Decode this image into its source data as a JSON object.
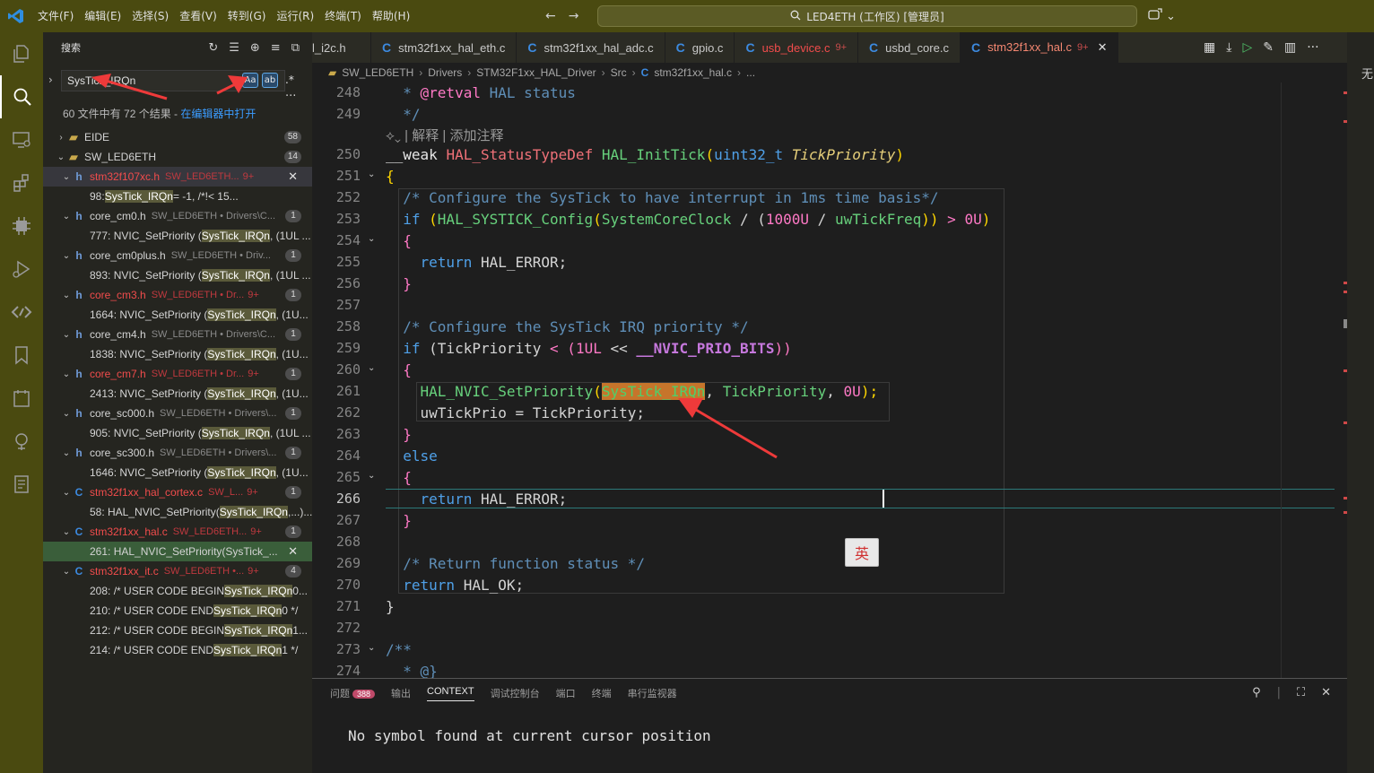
{
  "app": {
    "menu": [
      "文件(F)",
      "编辑(E)",
      "选择(S)",
      "查看(V)",
      "转到(G)",
      "运行(R)",
      "终端(T)",
      "帮助(H)"
    ],
    "search_center": "LED4ETH (工作区) [管理员]"
  },
  "activity_icons": [
    "explorer-icon",
    "search-icon",
    "remote-explorer-icon",
    "extensions-icon",
    "chip-icon",
    "run-debug-icon",
    "code-icon",
    "bookmark-icon",
    "calendar-icon",
    "bug-icon",
    "notes-icon"
  ],
  "sidebar": {
    "title": "搜索",
    "query": "SysTick_IRQn",
    "opt_case": "Aa",
    "opt_word": "ab",
    "opt_regex": ".*",
    "summary_prefix": "60 文件中有 72 个结果 - ",
    "summary_link": "在编辑器中打开",
    "tree": [
      {
        "kind": "folder",
        "name": "EIDE",
        "badge": "58",
        "expanded": false
      },
      {
        "kind": "folder",
        "name": "SW_LED6ETH",
        "badge": "14",
        "expanded": true
      },
      {
        "kind": "file",
        "type": "h",
        "name": "stm32f107xc.h",
        "path": "SW_LED6ETH...",
        "count": "9+",
        "error": true,
        "selected": true
      },
      {
        "kind": "match",
        "line": "98: ",
        "hl": "SysTick_IRQn",
        "rest": "            = -1,     /*!< 15..."
      },
      {
        "kind": "file",
        "type": "h",
        "name": "core_cm0.h",
        "path": "SW_LED6ETH • Drivers\\C...",
        "badge": "1"
      },
      {
        "kind": "match",
        "line": "777: NVIC_SetPriority (",
        "hl": "SysTick_IRQn",
        "rest": ", (1UL ..."
      },
      {
        "kind": "file",
        "type": "h",
        "name": "core_cm0plus.h",
        "path": "SW_LED6ETH • Driv...",
        "badge": "1"
      },
      {
        "kind": "match",
        "line": "893: NVIC_SetPriority (",
        "hl": "SysTick_IRQn",
        "rest": ", (1UL ..."
      },
      {
        "kind": "file",
        "type": "h",
        "name": "core_cm3.h",
        "path": "SW_LED6ETH • Dr...",
        "count": "9+",
        "badge": "1",
        "error": true
      },
      {
        "kind": "match",
        "line": "1664: NVIC_SetPriority (",
        "hl": "SysTick_IRQn",
        "rest": ", (1U..."
      },
      {
        "kind": "file",
        "type": "h",
        "name": "core_cm4.h",
        "path": "SW_LED6ETH • Drivers\\C...",
        "badge": "1"
      },
      {
        "kind": "match",
        "line": "1838: NVIC_SetPriority (",
        "hl": "SysTick_IRQn",
        "rest": ", (1U..."
      },
      {
        "kind": "file",
        "type": "h",
        "name": "core_cm7.h",
        "path": "SW_LED6ETH • Dr...",
        "count": "9+",
        "badge": "1",
        "error": true
      },
      {
        "kind": "match",
        "line": "2413: NVIC_SetPriority (",
        "hl": "SysTick_IRQn",
        "rest": ", (1U..."
      },
      {
        "kind": "file",
        "type": "h",
        "name": "core_sc000.h",
        "path": "SW_LED6ETH • Drivers\\...",
        "badge": "1"
      },
      {
        "kind": "match",
        "line": "905: NVIC_SetPriority (",
        "hl": "SysTick_IRQn",
        "rest": ", (1UL ..."
      },
      {
        "kind": "file",
        "type": "h",
        "name": "core_sc300.h",
        "path": "SW_LED6ETH • Drivers\\...",
        "badge": "1"
      },
      {
        "kind": "match",
        "line": "1646: NVIC_SetPriority (",
        "hl": "SysTick_IRQn",
        "rest": ", (1U..."
      },
      {
        "kind": "file",
        "type": "c",
        "name": "stm32f1xx_hal_cortex.c",
        "path": "SW_L...",
        "count": "9+",
        "badge": "1",
        "error": true
      },
      {
        "kind": "match",
        "line": "58: HAL_NVIC_SetPriority(",
        "hl": "SysTick_IRQn",
        "rest": ",...)..."
      },
      {
        "kind": "file",
        "type": "c",
        "name": "stm32f1xx_hal.c",
        "path": "SW_LED6ETH...",
        "count": "9+",
        "badge": "1",
        "error": true
      },
      {
        "kind": "match",
        "line": "261: HAL_NVIC_SetPriority(SysTick_...",
        "hl": "",
        "rest": "",
        "selected": true
      },
      {
        "kind": "file",
        "type": "c",
        "name": "stm32f1xx_it.c",
        "path": "SW_LED6ETH •...",
        "count": "9+",
        "badge": "4",
        "error": true
      },
      {
        "kind": "match",
        "line": "208: /* USER CODE BEGIN ",
        "hl": "SysTick_IRQn",
        "rest": " 0..."
      },
      {
        "kind": "match",
        "line": "210: /* USER CODE END ",
        "hl": "SysTick_IRQn",
        "rest": " 0 */"
      },
      {
        "kind": "match",
        "line": "212: /* USER CODE BEGIN ",
        "hl": "SysTick_IRQn",
        "rest": " 1..."
      },
      {
        "kind": "match",
        "line": "214: /* USER CODE END ",
        "hl": "SysTick_IRQn",
        "rest": " 1 */"
      }
    ]
  },
  "tabs": [
    {
      "label": "l_i2c.h",
      "icon": false
    },
    {
      "label": "stm32f1xx_hal_eth.c",
      "icon": true
    },
    {
      "label": "stm32f1xx_hal_adc.c",
      "icon": true
    },
    {
      "label": "gpio.c",
      "icon": true
    },
    {
      "label": "usb_device.c",
      "icon": true,
      "error": true,
      "count": "9+"
    },
    {
      "label": "usbd_core.c",
      "icon": true
    },
    {
      "label": "stm32f1xx_hal.c",
      "icon": true,
      "active": true,
      "count": "9+"
    }
  ],
  "breadcrumb": [
    "SW_LED6ETH",
    "Drivers",
    "STM32F1xx_HAL_Driver",
    "Src",
    "stm32f1xx_hal.c",
    "..."
  ],
  "codelens": "| 解释 | 添加注释",
  "code_lines": [
    {
      "n": "248",
      "segs": [
        [
          "  * ",
          "k-cm"
        ],
        [
          "@retval",
          "k-nm"
        ],
        [
          " HAL status",
          "k-cm"
        ]
      ]
    },
    {
      "n": "249",
      "segs": [
        [
          "  */",
          "k-cm"
        ]
      ]
    },
    {
      "n": "250",
      "segs": [
        [
          "__weak",
          "k-wk"
        ],
        [
          " ",
          "k-pu"
        ],
        [
          "HAL_StatusTypeDef",
          "k-ty"
        ],
        [
          " ",
          "k-pu"
        ],
        [
          "HAL_InitTick",
          "k-fn"
        ],
        [
          "(",
          "k-bp"
        ],
        [
          "uint32_t",
          "k-kw"
        ],
        [
          " ",
          "k-pu"
        ],
        [
          "TickPriority",
          "k-it"
        ],
        [
          ")",
          "k-bp"
        ]
      ]
    },
    {
      "n": "251",
      "fold": true,
      "segs": [
        [
          "{",
          "k-bp"
        ]
      ]
    },
    {
      "n": "252",
      "segs": [
        [
          "  /* Configure the SysTick to have interrupt in 1ms time basis*/",
          "k-cm"
        ]
      ]
    },
    {
      "n": "253",
      "segs": [
        [
          "  if",
          "k-kw"
        ],
        [
          " (",
          "k-bp"
        ],
        [
          "HAL_SYSTICK_Config",
          "k-fn"
        ],
        [
          "(",
          "k-bp"
        ],
        [
          "SystemCoreClock",
          "k-fn"
        ],
        [
          " / (",
          "k-pu"
        ],
        [
          "1000U",
          "k-nm"
        ],
        [
          " / ",
          "k-pu"
        ],
        [
          "uwTickFreq",
          "k-fn"
        ],
        [
          "))",
          "k-bp"
        ],
        [
          " > ",
          "k-nm"
        ],
        [
          "0U",
          "k-nm"
        ],
        [
          ")",
          "k-bp"
        ]
      ]
    },
    {
      "n": "254",
      "fold": true,
      "segs": [
        [
          "  {",
          "k-nm"
        ]
      ]
    },
    {
      "n": "255",
      "segs": [
        [
          "    return",
          "k-kw"
        ],
        [
          " HAL_ERROR;",
          "k-id"
        ]
      ]
    },
    {
      "n": "256",
      "segs": [
        [
          "  }",
          "k-nm"
        ]
      ]
    },
    {
      "n": "257",
      "segs": [
        [
          "",
          "k-pu"
        ]
      ]
    },
    {
      "n": "258",
      "segs": [
        [
          "  /* Configure the SysTick IRQ priority */",
          "k-cm"
        ]
      ]
    },
    {
      "n": "259",
      "segs": [
        [
          "  if",
          "k-kw"
        ],
        [
          " (TickPriority ",
          "k-id"
        ],
        [
          "<",
          "k-nm"
        ],
        [
          " (",
          "k-nm"
        ],
        [
          "1UL",
          "k-nm"
        ],
        [
          " << ",
          "k-pu"
        ],
        [
          "__NVIC_PRIO_BITS",
          "k-macro"
        ],
        [
          "))",
          "k-nm"
        ]
      ]
    },
    {
      "n": "260",
      "fold": true,
      "segs": [
        [
          "  {",
          "k-nm"
        ]
      ]
    },
    {
      "n": "261",
      "segs": [
        [
          "    ",
          "k-pu"
        ],
        [
          "HAL_NVIC_SetPriority",
          "k-fn"
        ],
        [
          "(",
          "k-bp"
        ],
        [
          "SysTick_IRQn",
          "hlmatch"
        ],
        [
          ", ",
          "k-pu"
        ],
        [
          "TickPriority",
          "k-fn"
        ],
        [
          ", ",
          "k-pu"
        ],
        [
          "0U",
          "k-nm"
        ],
        [
          ");",
          "k-bp"
        ]
      ]
    },
    {
      "n": "262",
      "segs": [
        [
          "    uwTickPrio = TickPriority;",
          "k-id"
        ]
      ]
    },
    {
      "n": "263",
      "segs": [
        [
          "  }",
          "k-nm"
        ]
      ]
    },
    {
      "n": "264",
      "segs": [
        [
          "  else",
          "k-kw"
        ]
      ]
    },
    {
      "n": "265",
      "fold": true,
      "segs": [
        [
          "  {",
          "k-nm"
        ]
      ]
    },
    {
      "n": "266",
      "segs": [
        [
          "    return",
          "k-kw"
        ],
        [
          " HAL_ERROR;",
          "k-id"
        ]
      ]
    },
    {
      "n": "267",
      "segs": [
        [
          "  }",
          "k-nm"
        ]
      ]
    },
    {
      "n": "268",
      "segs": [
        [
          "",
          "k-pu"
        ]
      ]
    },
    {
      "n": "269",
      "segs": [
        [
          "  /* Return function status */",
          "k-cm"
        ]
      ]
    },
    {
      "n": "270",
      "segs": [
        [
          "  return",
          "k-kw"
        ],
        [
          " HAL_OK;",
          "k-id"
        ]
      ]
    },
    {
      "n": "271",
      "segs": [
        [
          "}",
          "k-id"
        ]
      ]
    },
    {
      "n": "272",
      "segs": [
        [
          "",
          "k-pu"
        ]
      ]
    },
    {
      "n": "273",
      "fold": true,
      "segs": [
        [
          "/**",
          "k-cm"
        ]
      ]
    },
    {
      "n": "274",
      "segs": [
        [
          "  * @}",
          "k-cm"
        ]
      ]
    }
  ],
  "ime_label": "英",
  "panel": {
    "tabs": [
      {
        "label": "问题",
        "badge": "388"
      },
      {
        "label": "输出"
      },
      {
        "label": "CONTEXT",
        "active": true
      },
      {
        "label": "调试控制台"
      },
      {
        "label": "端口"
      },
      {
        "label": "终端"
      },
      {
        "label": "串行监视器"
      }
    ],
    "message": "No symbol found at current cursor position"
  },
  "right_strip_text": "无"
}
